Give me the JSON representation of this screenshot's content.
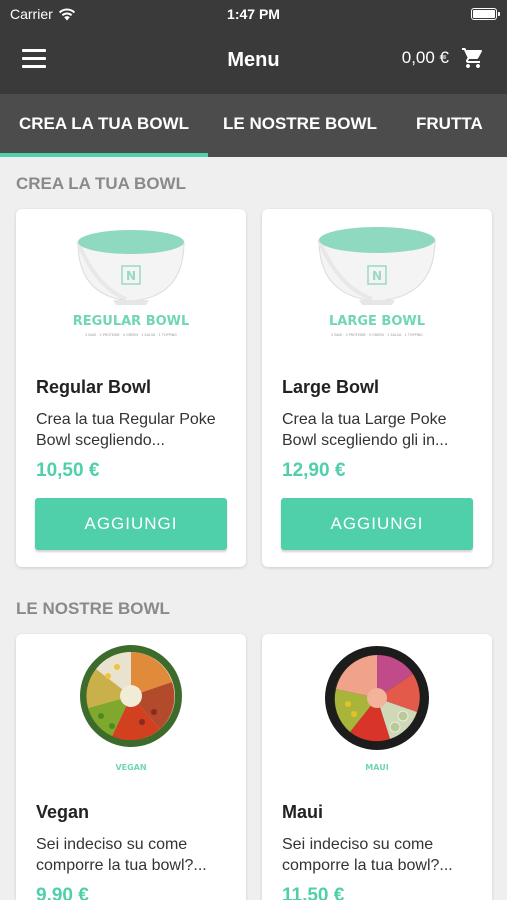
{
  "status_bar": {
    "carrier": "Carrier",
    "time": "1:47 PM"
  },
  "nav": {
    "title": "Menu",
    "cart_total": "0,00 €"
  },
  "tabs": [
    {
      "label": "CREA LA TUA BOWL",
      "active": true
    },
    {
      "label": "LE NOSTRE BOWL",
      "active": false
    },
    {
      "label": "FRUTTA",
      "active": false
    }
  ],
  "sections": [
    {
      "title": "CREA LA TUA BOWL",
      "products": [
        {
          "name": "Regular Bowl",
          "description": "Crea la tua Regular Poke Bowl scegliendo...",
          "price": "10,50 €",
          "button": "AGGIUNGI",
          "image_label": "REGULAR BOWL",
          "image_sublabel": "2 BASI · 2 PROTEINE · 4 GREEN · 1 SALSA · 1 TOPPING"
        },
        {
          "name": "Large Bowl",
          "description": "Crea la tua Large Poke Bowl scegliendo gli in...",
          "price": "12,90 €",
          "button": "AGGIUNGI",
          "image_label": "LARGE BOWL",
          "image_sublabel": "2 BASI · 3 PROTEINE · 5 GREEN · 1 SALSA · 1 TOPPING"
        }
      ]
    },
    {
      "title": "LE NOSTRE BOWL",
      "products": [
        {
          "name": "Vegan",
          "description": "Sei indeciso su come comporre la tua bowl?...",
          "price": "9,90 €",
          "image_label": "VEGAN"
        },
        {
          "name": "Maui",
          "description": "Sei indeciso su come comporre la tua bowl?...",
          "price": "11,50 €",
          "image_label": "MAUI"
        }
      ]
    }
  ],
  "colors": {
    "accent": "#4fcfaa",
    "header": "#3a3a3a",
    "tab_bar": "#4c4c4c",
    "background": "#efefef"
  }
}
